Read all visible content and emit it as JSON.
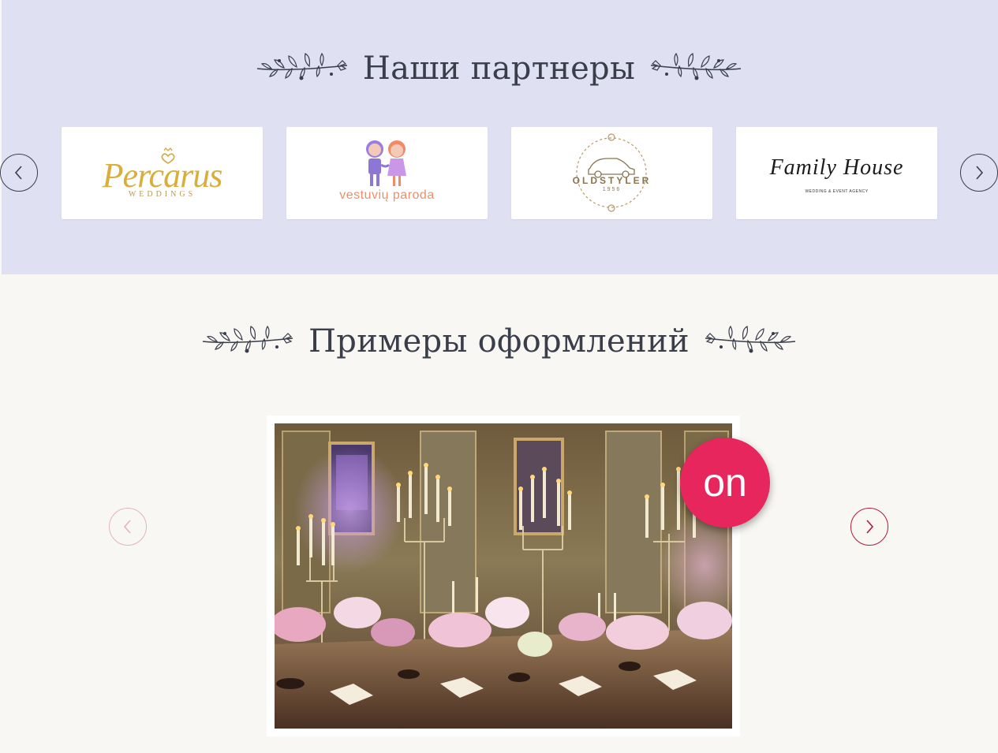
{
  "partners": {
    "title": "Наши партнеры",
    "logos": [
      {
        "name": "Percarus",
        "sub": "WEDDINGS"
      },
      {
        "name": "vestuvių paroda"
      },
      {
        "name": "OLDSTYLER",
        "sub": "1956"
      },
      {
        "name": "Family House",
        "sub": "WEDDING & EVENT AGENCY"
      }
    ],
    "prev_icon": "chevron-left-icon",
    "next_icon": "chevron-right-icon"
  },
  "gallery": {
    "title": "Примеры оформлений",
    "badge": "on",
    "prev_icon": "chevron-left-icon",
    "next_icon": "chevron-right-icon"
  },
  "colors": {
    "partners_bg": "#dfe0f2",
    "page_bg": "#f8f7f3",
    "title_text": "#3a3d4a",
    "badge": "#e8265e",
    "gallery_arrow": "#b01a3c"
  }
}
